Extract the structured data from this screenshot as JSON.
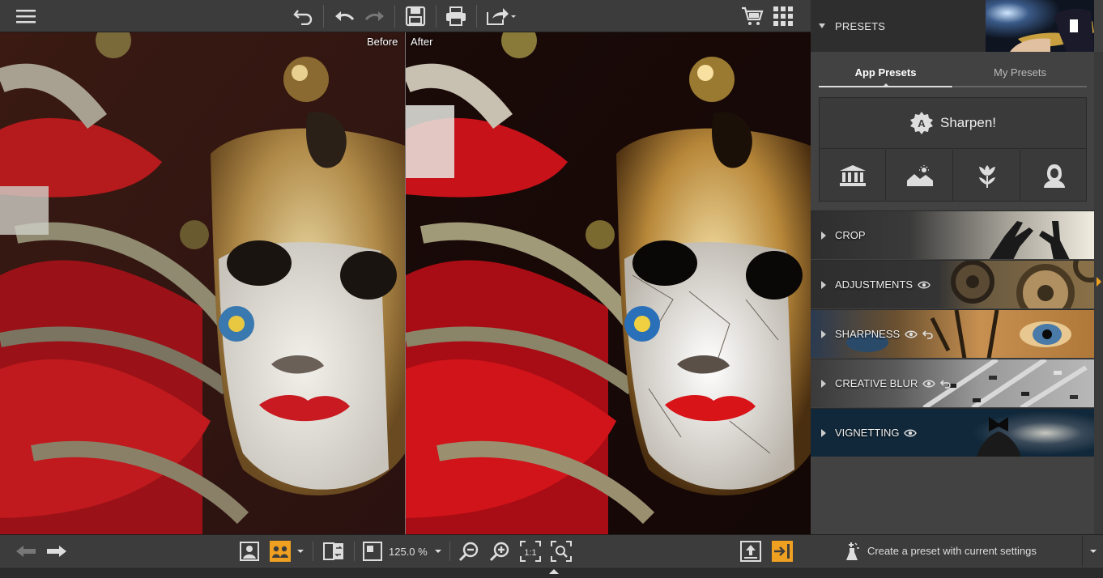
{
  "toolbar": {
    "menu_icon": "hamburger-icon",
    "undo_icon": "undo-icon",
    "redo_icon": "redo-icon",
    "save_icon": "save-icon",
    "print_icon": "print-icon",
    "export_icon": "export-icon",
    "cart_icon": "cart-icon",
    "apps_icon": "grid-icon"
  },
  "viewer": {
    "before_label": "Before",
    "after_label": "After"
  },
  "bottombar": {
    "zoom_value": "125.0 %"
  },
  "panel": {
    "presets_title": "PRESETS",
    "tabs": {
      "app": "App Presets",
      "my": "My Presets"
    },
    "sharpen_label": "Sharpen!",
    "preset_icons": [
      "museum-icon",
      "landscape-icon",
      "flower-icon",
      "portrait-icon"
    ],
    "sections": [
      {
        "title": "CROP"
      },
      {
        "title": "ADJUSTMENTS"
      },
      {
        "title": "SHARPNESS"
      },
      {
        "title": "CREATIVE BLUR"
      },
      {
        "title": "VIGNETTING"
      }
    ],
    "create_preset_label": "Create a preset with current settings"
  },
  "colors": {
    "accent": "#f0a020",
    "panel_bg": "#424242",
    "toolbar_bg": "#3c3c3c"
  }
}
